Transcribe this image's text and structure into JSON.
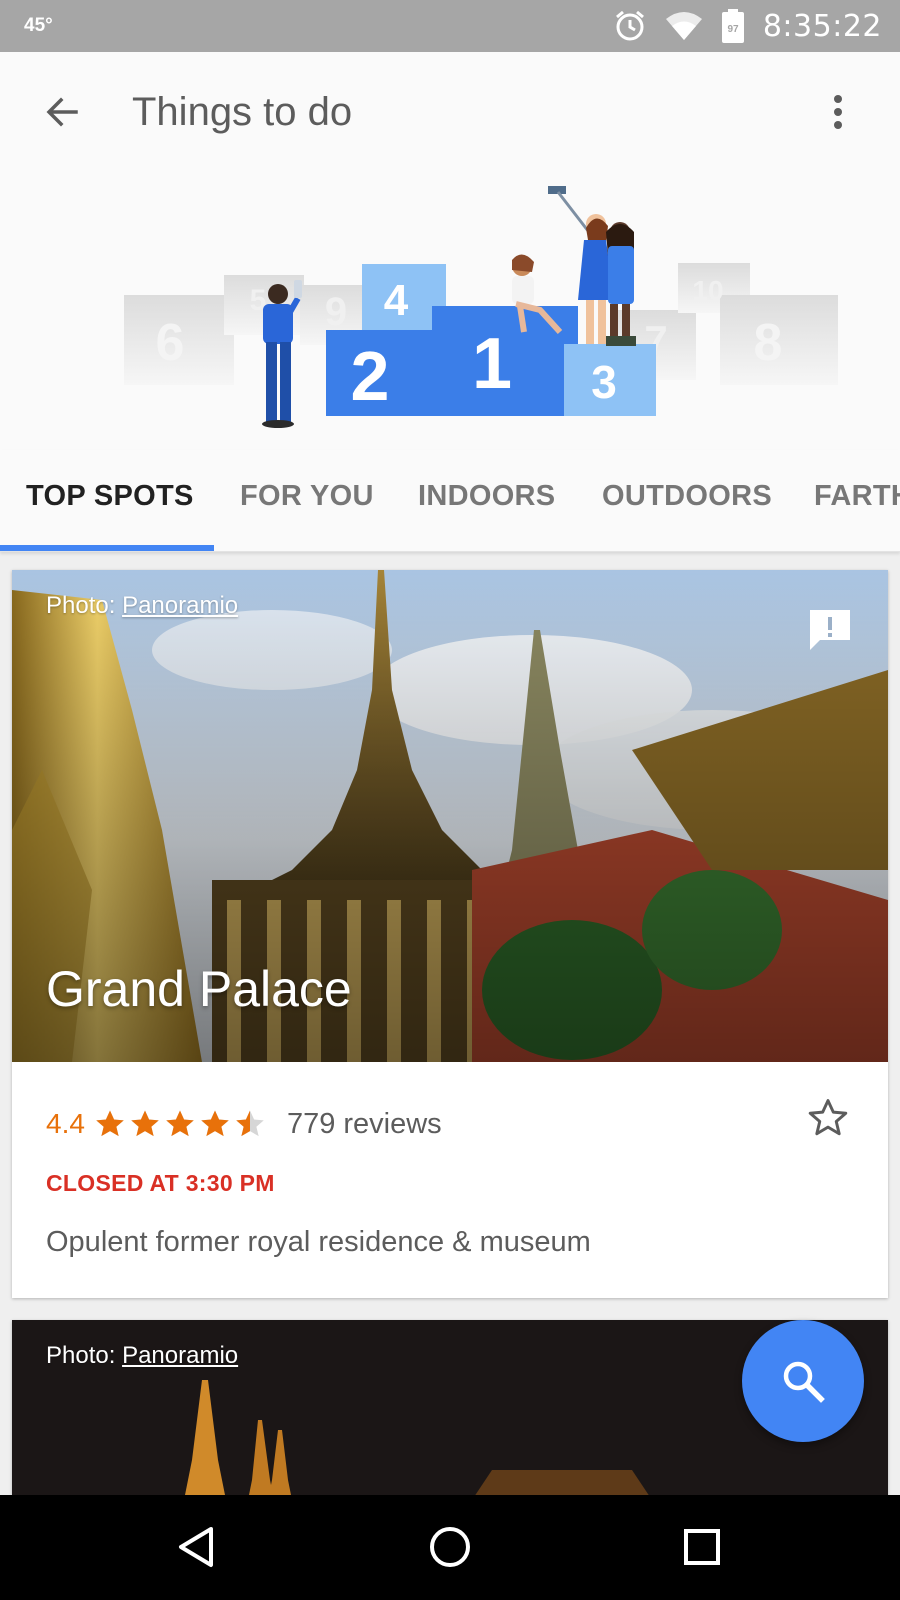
{
  "status_bar": {
    "temperature": "45°",
    "time": "8:35:22",
    "battery": "97",
    "icons": [
      "alarm-icon",
      "wifi-icon",
      "battery-icon"
    ]
  },
  "app_bar": {
    "title": "Things to do",
    "back_icon": "arrow-back-icon",
    "menu_icon": "more-vert-icon"
  },
  "hero": {
    "blocks": [
      "6",
      "5",
      "9",
      "4",
      "2",
      "1",
      "3",
      "7",
      "10",
      "8"
    ]
  },
  "tabs": [
    {
      "label": "TOP SPOTS",
      "active": true
    },
    {
      "label": "FOR YOU",
      "active": false
    },
    {
      "label": "INDOORS",
      "active": false
    },
    {
      "label": "OUTDOORS",
      "active": false
    },
    {
      "label": "FARTH",
      "active": false
    }
  ],
  "cards": [
    {
      "photo_prefix": "Photo: ",
      "photo_source": "Panoramio",
      "title": "Grand Palace",
      "rating": "4.4",
      "rating_value": 4.4,
      "reviews": "779 reviews",
      "hours": "CLOSED AT 3:30 PM",
      "description": "Opulent former royal residence & museum"
    },
    {
      "photo_prefix": "Photo: ",
      "photo_source": "Panoramio"
    }
  ],
  "fab": {
    "icon": "search-icon"
  },
  "colors": {
    "accent": "#4285f4",
    "rating": "#e8710a",
    "closed": "#d93025"
  },
  "nav_bar": {
    "icons": [
      "back-triangle-icon",
      "home-circle-icon",
      "recents-square-icon"
    ]
  }
}
